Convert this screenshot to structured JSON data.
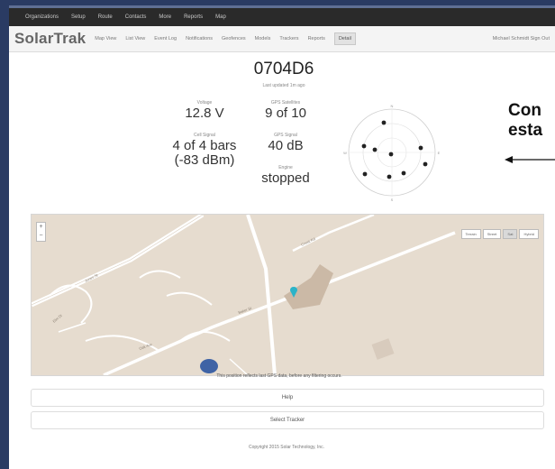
{
  "topbar": {
    "items": [
      "Organizations",
      "Setup",
      "Route",
      "Contacts",
      "More",
      "Reports",
      "Map"
    ]
  },
  "app": {
    "brand": "SolarTrak",
    "nav": [
      "Map View",
      "List View",
      "Event Log",
      "Notifications",
      "Geofences",
      "Models",
      "Trackers",
      "Reports",
      "Detail"
    ],
    "active_nav": "Detail",
    "user": "Michael Schmidt  Sign Out"
  },
  "tracker": {
    "id": "0704D6",
    "last_updated": "Last updated 1m ago",
    "voltage_label": "Voltage",
    "voltage": "12.8 V",
    "satellites_label": "GPS Satellites",
    "satellites": "9 of 10",
    "cell_label": "Cell Signal",
    "cell_bars": "4 of 4 bars",
    "cell_dbm": "(-83 dBm)",
    "gps_signal_label": "GPS Signal",
    "gps_signal": "40 dB",
    "engine_label": "Engine",
    "engine": "stopped"
  },
  "satellite_plot": {
    "compass": [
      "N",
      "E",
      "S",
      "W"
    ],
    "satellite_count": 9
  },
  "callout": {
    "line1": "Con",
    "line2": "esta"
  },
  "map": {
    "zoom_in": "+",
    "zoom_out": "−",
    "types": [
      "Terrain",
      "Street",
      "Sat",
      "Hybrid"
    ],
    "selected_type": "Sat",
    "road_labels": [
      "Jones St",
      "Baker St",
      "Oak Ave",
      "Elm Dr",
      "Creek Rd"
    ],
    "note": "This position reflects last GPS data, before any filtering occurs."
  },
  "buttons": {
    "help": "Help",
    "select_tracker": "Select Tracker"
  },
  "footer": "Copyright 2015 Solar Technology, Inc.",
  "colors": {
    "background": "#2a3b63",
    "topbar": "#2a2a2a",
    "marker": "#2bb3c8"
  }
}
